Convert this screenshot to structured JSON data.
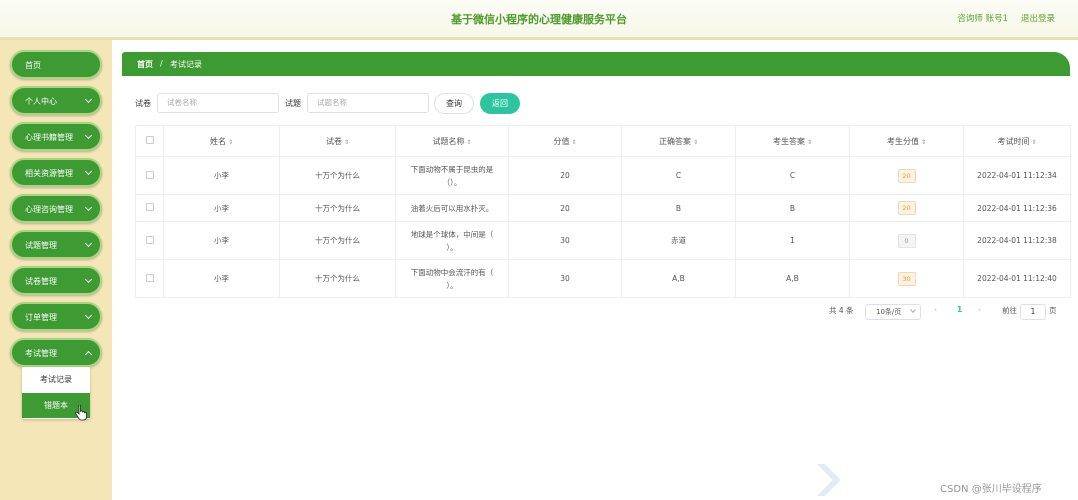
{
  "header": {
    "title": "基于微信小程序的心理健康服务平台",
    "user": "咨询师 账号1",
    "logout": "退出登录"
  },
  "sidebar": {
    "items": [
      {
        "label": "首页"
      },
      {
        "label": "个人中心"
      },
      {
        "label": "心理书籍管理"
      },
      {
        "label": "相关资源管理"
      },
      {
        "label": "心理咨询管理"
      },
      {
        "label": "试题管理"
      },
      {
        "label": "试卷管理"
      },
      {
        "label": "订单管理"
      },
      {
        "label": "考试管理"
      }
    ],
    "submenu": [
      {
        "label": "考试记录"
      },
      {
        "label": "错题本"
      }
    ]
  },
  "breadcrumb": {
    "home": "首页",
    "separator": "/",
    "current": "考试记录"
  },
  "search": {
    "paper_label": "试卷",
    "paper_placeholder": "试卷名称",
    "question_label": "试题",
    "question_placeholder": "试题名称",
    "query_button": "查询",
    "back_button": "返回"
  },
  "table": {
    "columns": [
      "姓名",
      "试卷",
      "试题名称",
      "分值",
      "正确答案",
      "考生答案",
      "考生分值",
      "考试时间"
    ],
    "sort_icon": "⇕",
    "rows": [
      {
        "name": "小李",
        "paper": "十万个为什么",
        "question": "下面动物不属于昆虫的是（）。",
        "score": "20",
        "correct": "C",
        "answer": "C",
        "got": "20",
        "time": "2022-04-01 11:12:34"
      },
      {
        "name": "小李",
        "paper": "十万个为什么",
        "question": "油着火后可以用水扑灭。",
        "score": "20",
        "correct": "B",
        "answer": "B",
        "got": "20",
        "time": "2022-04-01 11:12:36"
      },
      {
        "name": "小李",
        "paper": "十万个为什么",
        "question": "地球是个球体，中间是（ ）。",
        "score": "30",
        "correct": "赤道",
        "answer": "1",
        "got": "0",
        "time": "2022-04-01 11:12:38"
      },
      {
        "name": "小李",
        "paper": "十万个为什么",
        "question": "下面动物中会流汗的有（ ）。",
        "score": "30",
        "correct": "A,B",
        "answer": "A,B",
        "got": "30",
        "time": "2022-04-01 11:12:40"
      }
    ]
  },
  "pagination": {
    "total": "共 4 条",
    "page_size": "10条/页",
    "prev": "‹",
    "current": "1",
    "next": "›",
    "goto_label": "前往",
    "goto_value": "1",
    "goto_suffix": "页"
  },
  "watermark": "CSDN @张川毕设程序",
  "colors": {
    "primary": "#3e9a32",
    "accent": "#2ec4a0",
    "sidebar_bg": "#f5e6b8"
  }
}
